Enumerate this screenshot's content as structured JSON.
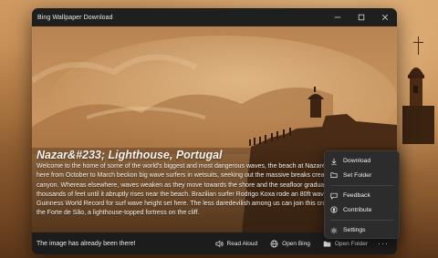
{
  "window": {
    "title": "Bing Wallpaper Download"
  },
  "image": {
    "title": "Nazar&#233; Lighthouse, Portugal",
    "description": "Welcome to the home of some of the world's biggest and most dangerous waves, the beach at Nazaré in Portugal.  The stormy winters you get here from October to March beckon big wave surfers in wetsuits, seeking out the massive breaks created by Europe's largest underwater canyon. Whereas elsewhere, waves weaken as they move towards the shore and the seafloor gradually rises, here there is no seafloor for thousands of feet until it abruptly rises near the beach.  Brazilian surfer Rodrigo Koxa rode an 80ft wave here in 2017, beating the previous Guinness World Record for surf wave height set here. The less daredevilish among us can join this crowd standing in awe from the safety of the Forte de São, a lighthouse-topped fortress on the cliff."
  },
  "status": {
    "text": "The image has already been there!"
  },
  "toolbar": {
    "read_aloud": "Read Aloud",
    "open_bing": "Open Bing",
    "open_folder": "Open Folder",
    "more": "···"
  },
  "menu": {
    "items": [
      {
        "label": "Download",
        "icon": "download-icon"
      },
      {
        "label": "Set Folder",
        "icon": "folder-icon"
      },
      {
        "label": "Feedback",
        "icon": "feedback-icon"
      },
      {
        "label": "Contribute",
        "icon": "github-icon"
      },
      {
        "label": "Settings",
        "icon": "gear-icon"
      }
    ]
  },
  "colors": {
    "window_bg": "#202020",
    "menu_bg": "#2c2c2c",
    "photo_tone": "#b98048"
  }
}
